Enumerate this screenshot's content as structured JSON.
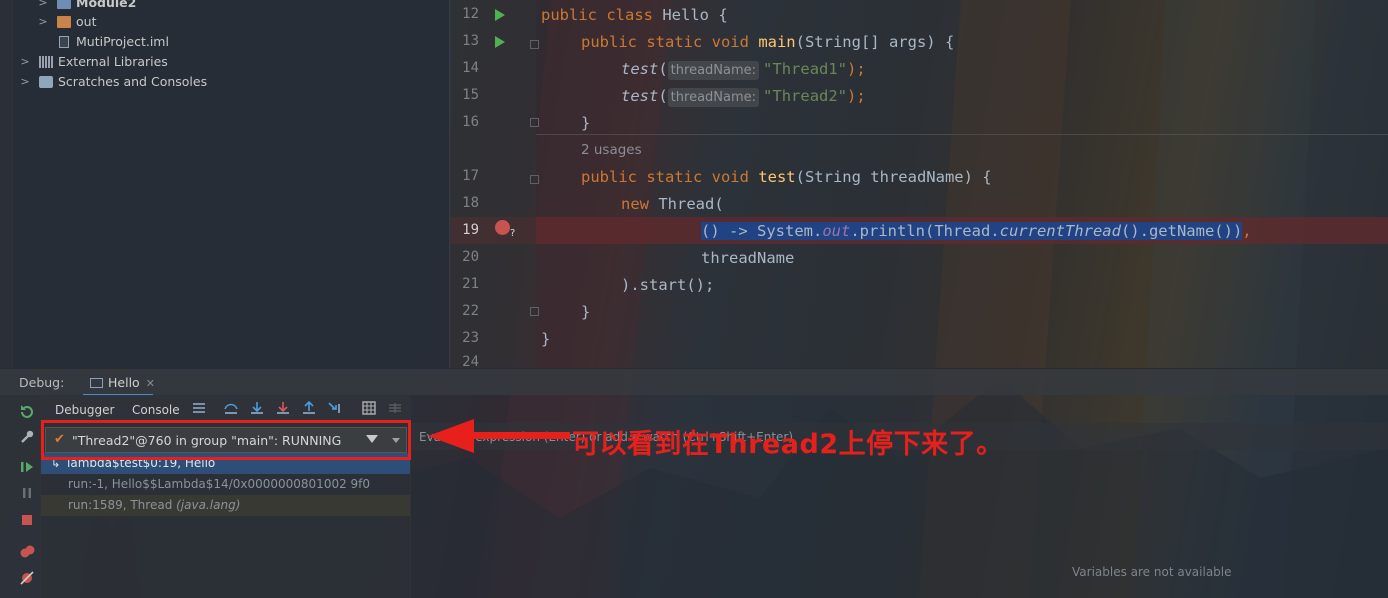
{
  "project_tree": [
    {
      "name": "module2",
      "label": "Module2",
      "icon": "module-icon",
      "chevron": true
    },
    {
      "name": "out",
      "label": "out",
      "icon": "folder-icon",
      "chevron": true
    },
    {
      "name": "iml",
      "label": "MutiProject.iml",
      "icon": "file-icon",
      "chevron": false
    },
    {
      "name": "external-libraries",
      "label": "External Libraries",
      "icon": "libraries-icon",
      "chevron": true
    },
    {
      "name": "scratches",
      "label": "Scratches and Consoles",
      "icon": "scratches-icon",
      "chevron": true
    }
  ],
  "editor": {
    "line_numbers": [
      "12",
      "13",
      "14",
      "15",
      "16",
      "17",
      "18",
      "19",
      "20",
      "21",
      "22",
      "23",
      "24"
    ],
    "usages": "2 usages",
    "code": {
      "l12": {
        "kw": "public class ",
        "name": "Hello",
        "rest": " {"
      },
      "l13": {
        "kw": "public static void ",
        "fn": "main",
        "rest": "(String[] args) {"
      },
      "l14": {
        "call": "test",
        "open": "(",
        "hint": "threadName:",
        "str": "\"Thread1\"",
        "close": ");"
      },
      "l15": {
        "call": "test",
        "open": "(",
        "hint": "threadName:",
        "str": "\"Thread2\"",
        "close": ");"
      },
      "l16": {
        "text": "}"
      },
      "l17": {
        "kw": "public static void ",
        "fn": "test",
        "rest": "(String threadName) {"
      },
      "l18": {
        "kw": "new ",
        "rest": "Thread("
      },
      "l19": {
        "pre": "() -> System.",
        "field": "out",
        "mid": ".println(Thread.",
        "it": "currentThread",
        "post": "().getName())",
        "comma": ","
      },
      "l20": {
        "text": "threadName"
      },
      "l21": {
        "text": ").start();"
      },
      "l22": {
        "text": "}"
      },
      "l23": {
        "text": "}"
      }
    }
  },
  "debug": {
    "title": "Debug:",
    "tab_label": "Hello",
    "tabs": {
      "debugger": "Debugger",
      "console": "Console"
    },
    "thread_selector": "\"Thread2\"@760 in group \"main\": RUNNING",
    "frames": [
      "lambda$test$0:19, Hello",
      "run:-1, Hello$$Lambda$14/0x0000000801002 9f0",
      "run:1589, Thread"
    ],
    "frame2_pkg": "(java.lang)",
    "eval_hint": "Evaluate expression (Enter) or add a watch (Ctrl+Shift+Enter)",
    "vars_empty": "Variables are not available"
  },
  "annotation": {
    "text": "可以看到在Thread2上停下来了。",
    "color": "#e8201b"
  }
}
